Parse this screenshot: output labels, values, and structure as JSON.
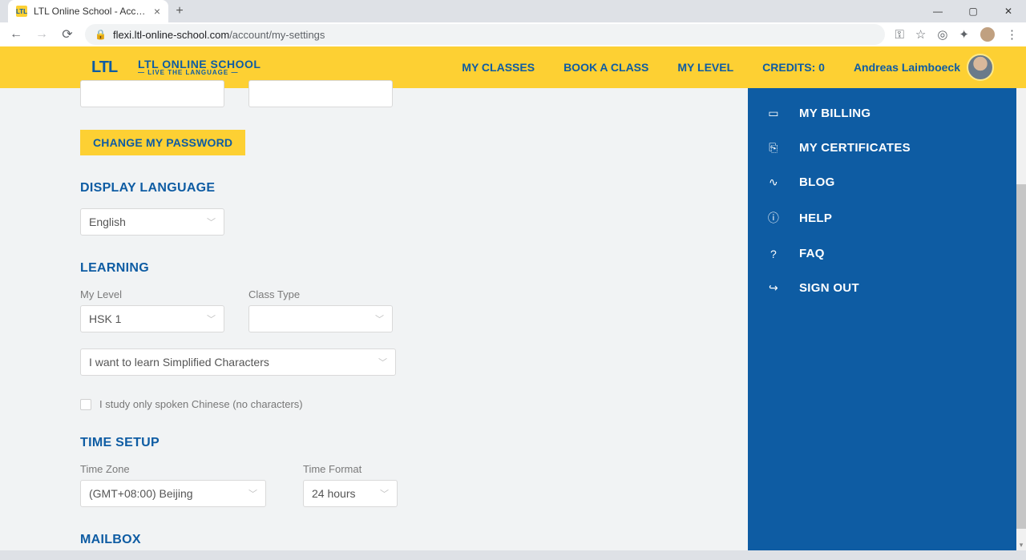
{
  "browser": {
    "tab_title": "LTL Online School - Account",
    "url_host": "flexi.ltl-online-school.com",
    "url_path": "/account/my-settings"
  },
  "header": {
    "logo_main": "LTL ONLINE SCHOOL",
    "logo_sub": "— LIVE THE LANGUAGE —",
    "nav": {
      "my_classes": "MY CLASSES",
      "book_class": "BOOK A CLASS",
      "my_level": "MY LEVEL",
      "credits": "CREDITS: 0",
      "user_name": "Andreas Laimboeck"
    }
  },
  "form": {
    "change_password_btn": "CHANGE MY PASSWORD",
    "sections": {
      "display_language": "DISPLAY LANGUAGE",
      "learning": "LEARNING",
      "time_setup": "TIME SETUP",
      "mailbox": "MAILBOX"
    },
    "labels": {
      "my_level": "My Level",
      "class_type": "Class Type",
      "time_zone": "Time Zone",
      "time_format": "Time Format"
    },
    "values": {
      "language": "English",
      "level": "HSK 1",
      "class_type": "",
      "char_pref": "I want to learn Simplified Characters",
      "spoken_only": "I study only spoken Chinese (no characters)",
      "timezone": "(GMT+08:00) Beijing",
      "time_format": "24 hours"
    }
  },
  "sidebar": {
    "items": [
      {
        "icon": "▭",
        "label": "MY BILLING"
      },
      {
        "icon": "⎘",
        "label": "MY CERTIFICATES"
      },
      {
        "icon": "∿",
        "label": "BLOG"
      },
      {
        "icon": "ⓘ",
        "label": "HELP"
      },
      {
        "icon": "?",
        "label": "FAQ"
      },
      {
        "icon": "↪",
        "label": "SIGN OUT"
      }
    ]
  }
}
